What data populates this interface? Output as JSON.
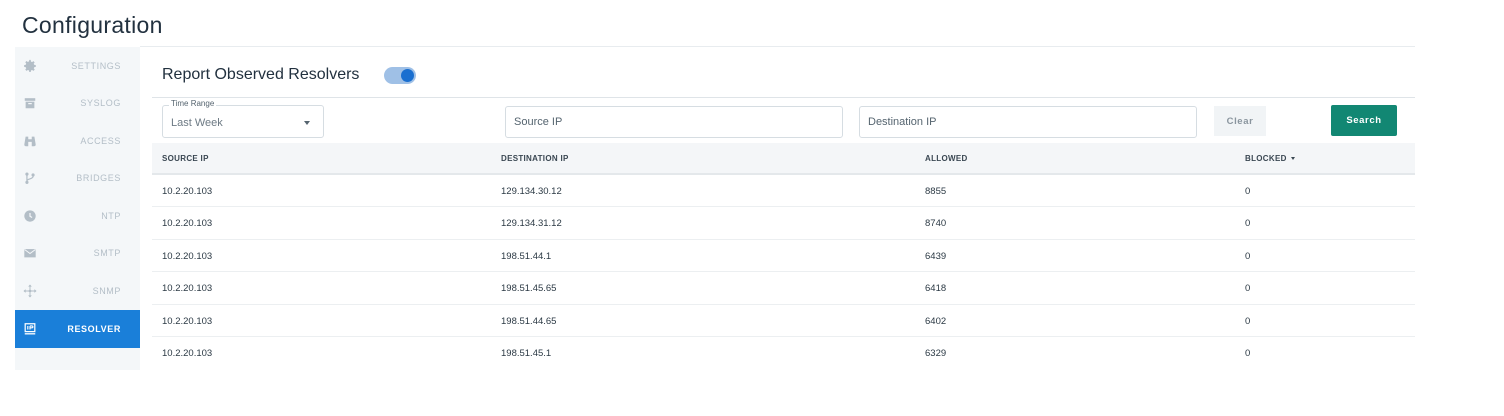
{
  "page": {
    "title": "Configuration"
  },
  "sidebar": {
    "items": [
      {
        "label": "SETTINGS",
        "icon": "gear-icon",
        "active": false
      },
      {
        "label": "SYSLOG",
        "icon": "archive-icon",
        "active": false
      },
      {
        "label": "ACCESS",
        "icon": "binoculars-icon",
        "active": false
      },
      {
        "label": "BRIDGES",
        "icon": "branch-icon",
        "active": false
      },
      {
        "label": "NTP",
        "icon": "clock-icon",
        "active": false
      },
      {
        "label": "SMTP",
        "icon": "envelope-icon",
        "active": false
      },
      {
        "label": "SNMP",
        "icon": "network-icon",
        "active": false
      },
      {
        "label": "RESOLVER",
        "icon": "resolver-icon",
        "active": true
      }
    ]
  },
  "header": {
    "report_label": "Report Observed Resolvers",
    "toggle_on": true
  },
  "filters": {
    "time_range_label": "Time Range",
    "time_range_value": "Last Week",
    "source_placeholder": "Source IP",
    "destination_placeholder": "Destination IP",
    "clear_label": "Clear",
    "search_label": "Search"
  },
  "table": {
    "columns": [
      "SOURCE IP",
      "DESTINATION IP",
      "ALLOWED",
      "BLOCKED"
    ],
    "rows": [
      [
        "10.2.20.103",
        "129.134.30.12",
        "8855",
        "0"
      ],
      [
        "10.2.20.103",
        "129.134.31.12",
        "8740",
        "0"
      ],
      [
        "10.2.20.103",
        "198.51.44.1",
        "6439",
        "0"
      ],
      [
        "10.2.20.103",
        "198.51.45.65",
        "6418",
        "0"
      ],
      [
        "10.2.20.103",
        "198.51.44.65",
        "6402",
        "0"
      ],
      [
        "10.2.20.103",
        "198.51.45.1",
        "6329",
        "0"
      ]
    ]
  },
  "colors": {
    "accent": "#1a7fd9",
    "search_button": "#128773",
    "sidebar_bg": "#f4f7f9"
  }
}
